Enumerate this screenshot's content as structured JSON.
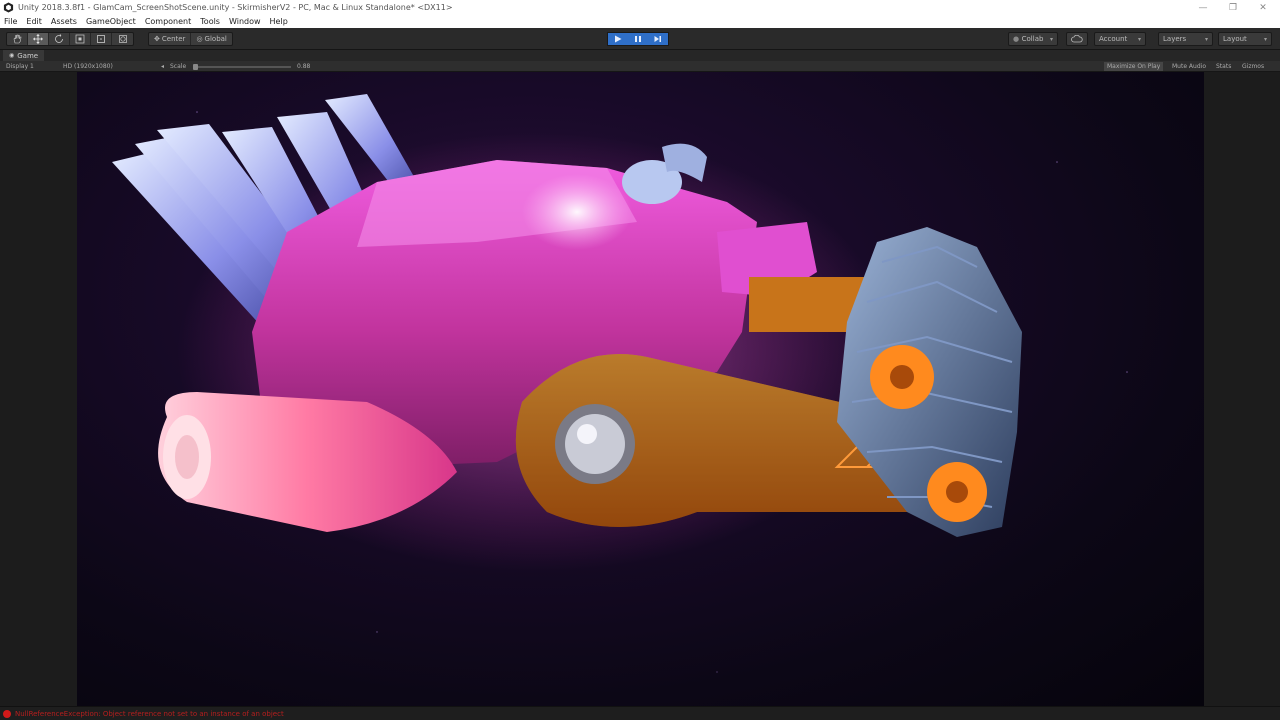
{
  "window": {
    "title": "Unity 2018.3.8f1 - GlamCam_ScreenShotScene.unity - SkirmisherV2 - PC, Mac & Linux Standalone* <DX11>",
    "minimize_glyph": "—",
    "maximize_glyph": "❐",
    "close_glyph": "✕"
  },
  "menu": [
    "File",
    "Edit",
    "Assets",
    "GameObject",
    "Component",
    "Tools",
    "Window",
    "Help"
  ],
  "toolbar": {
    "transform_tools": [
      "hand-icon",
      "move-icon",
      "rotate-icon",
      "scale-icon",
      "rect-icon",
      "transform-icon"
    ],
    "active_tool": "move-icon",
    "pivot_label": "Center",
    "space_label": "Global",
    "collab_label": "Collab",
    "account_label": "Account",
    "layers_label": "Layers",
    "layout_label": "Layout",
    "play_active": true,
    "accent_color": "#2f6fc8"
  },
  "game_view": {
    "tab_label": "Game",
    "display": "Display 1",
    "resolution": "HD (1920x1080)",
    "scale_label": "Scale",
    "scale_value": "0.88",
    "buttons": [
      "Maximize On Play",
      "Mute Audio",
      "Stats",
      "Gizmos"
    ],
    "maximize_on_play_pressed": true
  },
  "status": {
    "message": "NullReferenceException: Object reference not set to an instance of an object",
    "level": "error",
    "color": "#b51e1e"
  }
}
